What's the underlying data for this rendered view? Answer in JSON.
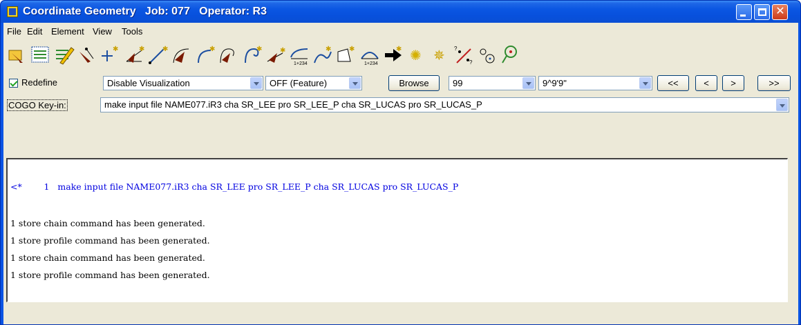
{
  "window": {
    "title": "Coordinate Geometry   Job: 077   Operator: R3",
    "icon": "cogo-app-icon"
  },
  "menu": [
    {
      "label": "File"
    },
    {
      "label": "Edit"
    },
    {
      "label": "Element"
    },
    {
      "label": "View"
    },
    {
      "label": "Tools"
    }
  ],
  "toolbar": {
    "tools": [
      "select-point-icon",
      "list-points-icon",
      "edit-points-icon",
      "locate-point-icon",
      "store-point-icon",
      "angle-icon",
      "line-icon",
      "curve-icon",
      "curve-point-icon",
      "spiral-icon",
      "spiral-point-icon",
      "chain-icon",
      "stationing-icon",
      "alignment-icon",
      "parcel-icon",
      "profile-stationing-icon",
      "arrow-right-icon",
      "burst-icon",
      "burst-star-icon",
      "percent-points-icon",
      "circle-points-icon",
      "search-icon"
    ],
    "station_label": "1+234"
  },
  "controls": {
    "redefine_label": "Redefine",
    "redefine_checked": true,
    "visualization": "Disable Visualization",
    "feature": "OFF (Feature)",
    "browse_label": "Browse",
    "number": "99",
    "angle": "9^9'9\"",
    "nav_first": "<<",
    "nav_prev": "<",
    "nav_next": ">",
    "nav_last": ">>"
  },
  "keyin": {
    "label": "COGO Key-in:",
    "value": "make input file NAME077.iR3 cha SR_LEE pro SR_LEE_P cha SR_LUCAS pro SR_LUCAS_P"
  },
  "output": {
    "command_line": "<*        1   make input file NAME077.iR3 cha SR_LEE pro SR_LEE_P cha SR_LUCAS pro SR_LUCAS_P",
    "messages": [
      "1 store chain command has been generated.",
      "1 store profile command has been generated.",
      "1 store chain command has been generated.",
      "1 store profile command has been generated."
    ]
  },
  "colors": {
    "titlebar": "#0a54e4",
    "command_text": "#0000e0",
    "client_bg": "#ece9d8"
  }
}
